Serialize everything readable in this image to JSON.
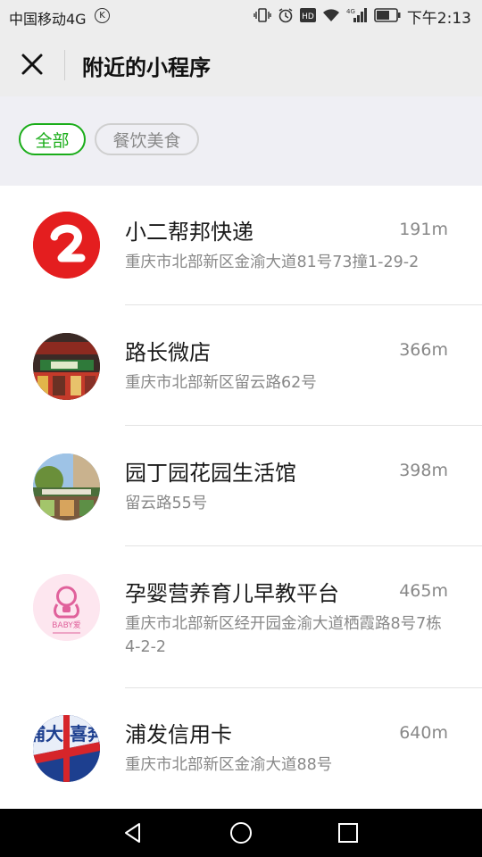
{
  "status": {
    "carrier": "中国移动4G",
    "time": "下午2:13",
    "network": "4G"
  },
  "header": {
    "title": "附近的小程序"
  },
  "filters": {
    "all": "全部",
    "food": "餐饮美食"
  },
  "items": [
    {
      "name": "小二帮邦快递",
      "distance": "191m",
      "address": "重庆市北部新区金渝大道81号73撞1-29-2",
      "avatar": "red-2-logo"
    },
    {
      "name": "路长微店",
      "distance": "366m",
      "address": "重庆市北部新区留云路62号",
      "avatar": "storefront-photo"
    },
    {
      "name": "园丁园花园生活馆",
      "distance": "398m",
      "address": "留云路55号",
      "avatar": "garden-shop-photo"
    },
    {
      "name": "孕婴营养育儿早教平台",
      "distance": "465m",
      "address": "重庆市北部新区经开园金渝大道栖霞路8号7栋4-2-2",
      "avatar": "baby-logo",
      "avatar_text": "BABY爱"
    },
    {
      "name": "浦发信用卡",
      "distance": "640m",
      "address": "重庆市北部新区金渝大道88号",
      "avatar": "spdb-card-logo",
      "avatar_text": "浦大 喜奔"
    }
  ],
  "colors": {
    "accent_green": "#1aad19",
    "header_bg": "#ededed",
    "filter_bg": "#efeff4"
  }
}
